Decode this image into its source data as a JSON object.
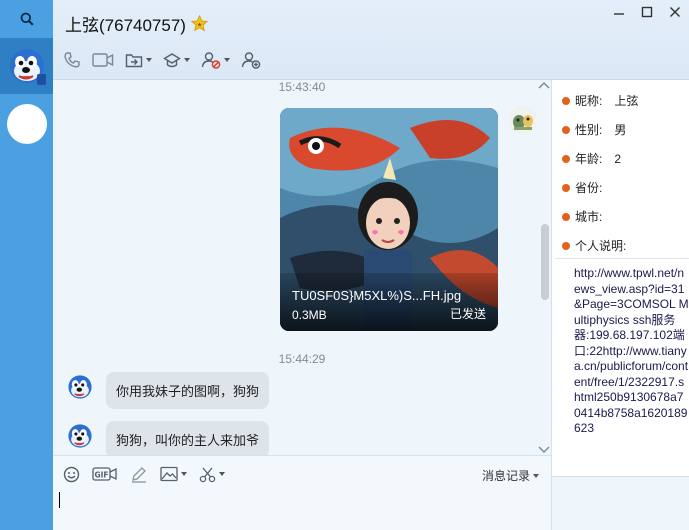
{
  "window": {
    "title": "上弦(76740757)",
    "controls": [
      "minimize-icon",
      "maximize-icon",
      "close-icon"
    ]
  },
  "sidebar": {
    "items": [
      {
        "name": "search",
        "icon": "search-icon"
      },
      {
        "name": "contact-active",
        "icon": "dog-avatar"
      },
      {
        "name": "contact-blank",
        "icon": "blank-avatar"
      }
    ]
  },
  "toolbar": {
    "items": [
      "phone-icon",
      "video-icon",
      "share-screen-icon",
      "remote-assist-icon",
      "block-user-icon",
      "add-friend-icon"
    ]
  },
  "chat": {
    "messages": [
      {
        "type": "timestamp",
        "text": "15:43:40"
      },
      {
        "type": "file",
        "sender": "self",
        "file_name": "TU0SF0S}M5XL%)S...FH.jpg",
        "file_size": "0.3MB",
        "status": "已发送"
      },
      {
        "type": "timestamp",
        "text": "15:44:29"
      },
      {
        "type": "text",
        "sender": "contact",
        "text": "你用我妹子的图啊，狗狗"
      },
      {
        "type": "text",
        "sender": "contact",
        "text": "狗狗，叫你的主人来加爷"
      }
    ]
  },
  "input": {
    "toolbar_icons": [
      "emoji-icon",
      "gif-icon",
      "pen-icon",
      "image-icon",
      "scissors-icon"
    ],
    "history_label": "消息记录"
  },
  "profile": {
    "fields": [
      {
        "label": "昵称:",
        "value": "上弦"
      },
      {
        "label": "性别:",
        "value": "男"
      },
      {
        "label": "年龄:",
        "value": "2"
      },
      {
        "label": "省份:",
        "value": ""
      },
      {
        "label": "城市:",
        "value": ""
      },
      {
        "label": "个人说明:",
        "value": ""
      }
    ],
    "description": "http://www.tpwl.net/news_view.asp?id=31&Page=3COMSOL Multiphysics ssh服务器:199.68.197.102端口:22http://www.tianya.cn/publicforum/content/free/1/2322917.shtml250b9130678a70414b8758a1620189623"
  },
  "colors": {
    "sidebar": "#4aa0e0",
    "sidebar_active": "#2f7fc4",
    "accent_dot": "#e4611b"
  }
}
